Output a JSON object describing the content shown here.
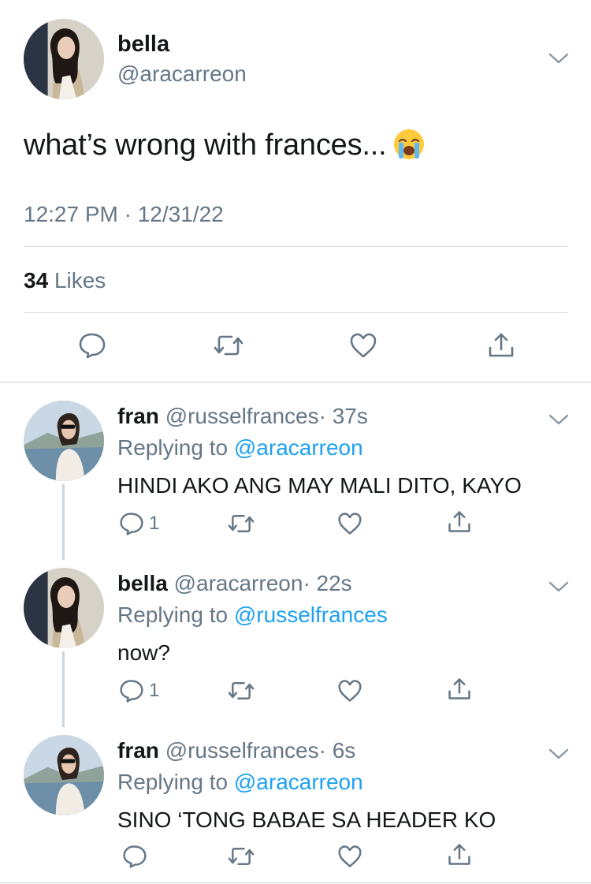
{
  "main_tweet": {
    "name": "bella",
    "handle": "@aracarreon",
    "text": "what’s wrong with frances...",
    "emoji": "loudly-crying-face",
    "timestamp": "12:27 PM · 12/31/22",
    "likes_count": "34",
    "likes_label": "Likes",
    "actions": [
      "reply-icon",
      "retweet-icon",
      "like-icon",
      "share-icon"
    ]
  },
  "replies": [
    {
      "name": "fran",
      "handle": "@russelfrances",
      "time": "· 37s",
      "replying_prefix": "Replying to",
      "replying_to": "@aracarreon",
      "text": "HINDI AKO ANG MAY MALI DITO, KAYO",
      "reply_count": "1"
    },
    {
      "name": "bella",
      "handle": "@aracarreon",
      "time": "· 22s",
      "replying_prefix": "Replying to",
      "replying_to": "@russelfrances",
      "text": "now?",
      "reply_count": "1"
    },
    {
      "name": "fran",
      "handle": "@russelfrances",
      "time": "· 6s",
      "replying_prefix": "Replying to",
      "replying_to": "@aracarreon",
      "text": "SINO ‘TONG BABAE SA HEADER KO",
      "reply_count": ""
    }
  ],
  "colors": {
    "text": "#14171a",
    "secondary": "#657786",
    "link": "#1da1f2",
    "divider": "#d9dee2",
    "icon": "#657786"
  }
}
